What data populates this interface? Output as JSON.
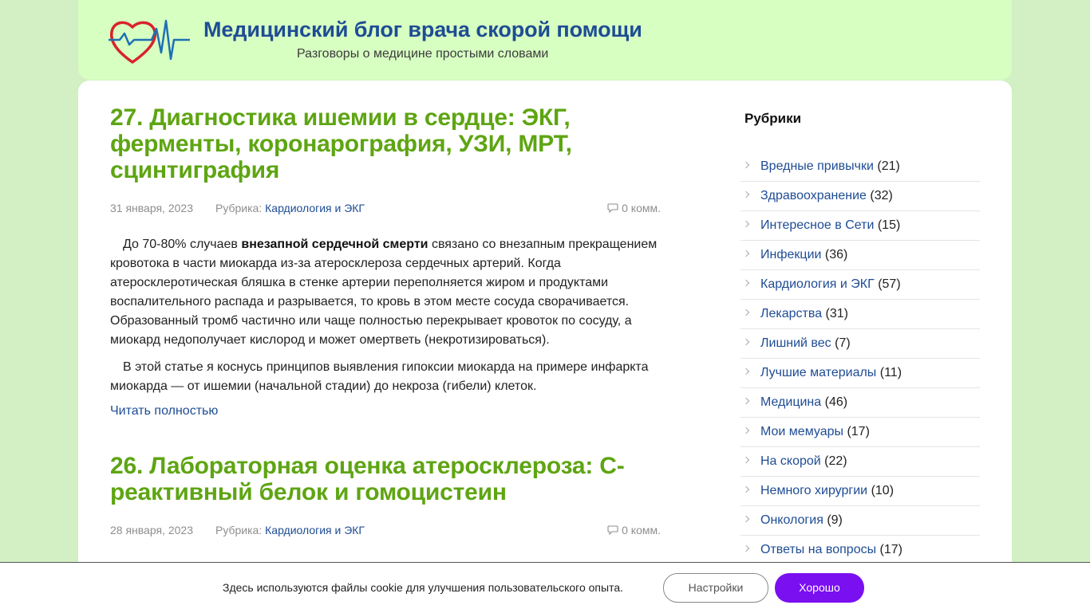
{
  "site": {
    "title": "Медицинский блог врача скорой помощи",
    "description": "Разговоры о медицине простыми словами",
    "logo_icon": "heart-cardiogram-icon"
  },
  "posts": [
    {
      "title": "27. Диагностика ишемии в сердце: ЭКГ, ферменты, коронарография, УЗИ, МРТ, сцинтиграфия",
      "date": "31 января, 2023",
      "rubric_label": "Рубрика:",
      "rubric": "Кардиология и ЭКГ",
      "comments": "0 комм.",
      "p1_before": "До 70-80% случаев ",
      "p1_bold": "внезапной сердечной смерти",
      "p1_after": " связано со внезапным прекращением кровотока в части миокарда из-за атеросклероза сердечных артерий. Когда атеросклеротическая бляшка в стенке артерии переполняется жиром и продуктами воспалительного распада и разрывается, то кровь в этом месте сосуда сворачивается. Образованный тромб частично или чаще полностью перекрывает кровоток по сосуду, а миокард недополучает кислород и может омертветь (некротизироваться).",
      "p2": "В этой статье я коснусь принципов выявления гипоксии миокарда на примере инфаркта миокарда — от ишемии (начальной стадии) до некроза (гибели) клеток.",
      "read_more": "Читать полностью"
    },
    {
      "title": "26. Лабораторная оценка атеросклероза: С-реактивный белок и гомоцистеин",
      "date": "28 января, 2023",
      "rubric_label": "Рубрика:",
      "rubric": "Кардиология и ЭКГ",
      "comments": "0 комм."
    }
  ],
  "sidebar": {
    "title": "Рубрики",
    "categories": [
      {
        "name": "Вредные привычки",
        "count": "(21)"
      },
      {
        "name": "Здравоохранение",
        "count": "(32)"
      },
      {
        "name": "Интересное в Сети",
        "count": "(15)"
      },
      {
        "name": "Инфекции",
        "count": "(36)"
      },
      {
        "name": "Кардиология и ЭКГ",
        "count": "(57)"
      },
      {
        "name": "Лекарства",
        "count": "(31)"
      },
      {
        "name": "Лишний вес",
        "count": "(7)"
      },
      {
        "name": "Лучшие материалы",
        "count": "(11)"
      },
      {
        "name": "Медицина",
        "count": "(46)"
      },
      {
        "name": "Мои мемуары",
        "count": "(17)"
      },
      {
        "name": "На скорой",
        "count": "(22)"
      },
      {
        "name": "Немного хирургии",
        "count": "(10)"
      },
      {
        "name": "Онкология",
        "count": "(9)"
      },
      {
        "name": "Ответы на вопросы",
        "count": "(17)"
      }
    ]
  },
  "cookie": {
    "text": "Здесь используются файлы cookie для улучшения пользовательского опыта.",
    "settings_label": "Настройки",
    "ok_label": "Хорошо"
  },
  "colors": {
    "page_bg": "#d2f0c3",
    "header_bg": "#d7ffc2",
    "title_green": "#5ea512",
    "link_blue": "#1e4c94",
    "button_purple": "#7a0ff0"
  }
}
